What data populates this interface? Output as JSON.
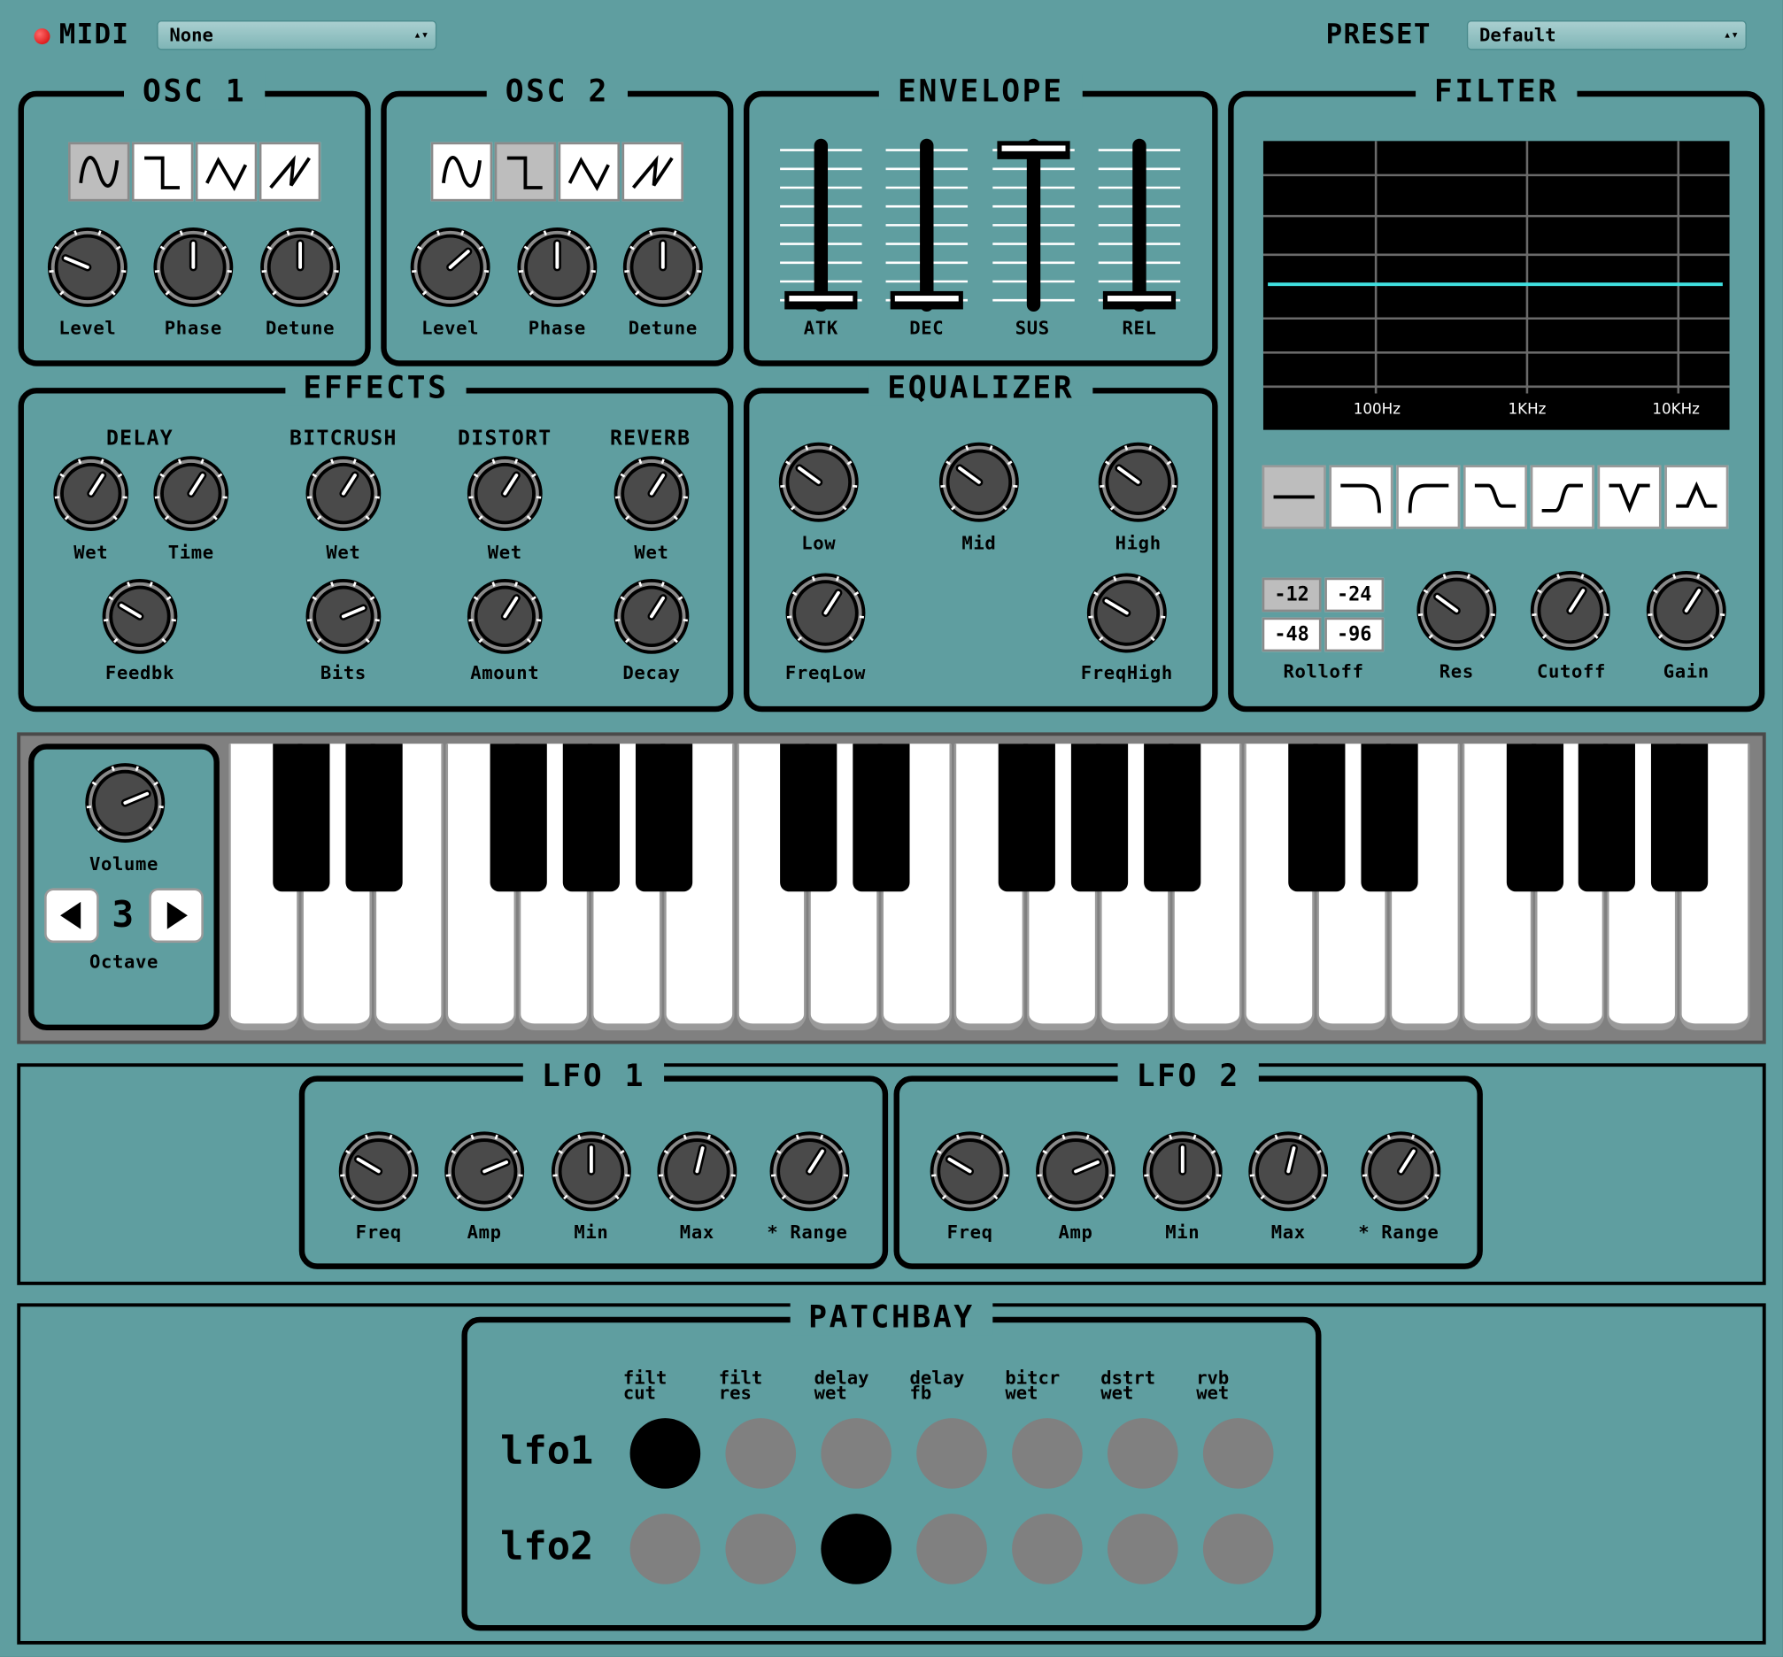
{
  "header": {
    "midi_label": "MIDI",
    "midi_value": "None",
    "preset_label": "PRESET",
    "preset_value": "Default"
  },
  "osc1": {
    "title": "OSC 1",
    "knobs": [
      {
        "label": "Level",
        "value": 0.25
      },
      {
        "label": "Phase",
        "value": 0.5
      },
      {
        "label": "Detune",
        "value": 0.5
      }
    ],
    "waveform": "sine"
  },
  "osc2": {
    "title": "OSC 2",
    "knobs": [
      {
        "label": "Level",
        "value": 0.68
      },
      {
        "label": "Phase",
        "value": 0.5
      },
      {
        "label": "Detune",
        "value": 0.5
      }
    ],
    "waveform": "square"
  },
  "envelope": {
    "title": "ENVELOPE",
    "sliders": [
      {
        "label": "ATK",
        "value": 0
      },
      {
        "label": "DEC",
        "value": 0
      },
      {
        "label": "SUS",
        "value": 1
      },
      {
        "label": "REL",
        "value": 0
      }
    ]
  },
  "filter": {
    "title": "FILTER",
    "freq_labels": [
      "100Hz",
      "1KHz",
      "10KHz"
    ],
    "types": [
      "flat",
      "lowpass",
      "highpass",
      "lowshelf",
      "highshelf",
      "notch",
      "peak"
    ],
    "selected_type": "flat",
    "rolloff_label": "Rolloff",
    "rolloffs": [
      "-12",
      "-24",
      "-48",
      "-96"
    ],
    "selected_rolloff": "-12",
    "knobs": [
      {
        "label": "Res",
        "value": 0.3
      },
      {
        "label": "Cutoff",
        "value": 0.62
      },
      {
        "label": "Gain",
        "value": 0.62
      }
    ],
    "line_color": "#40e0e0"
  },
  "effects": {
    "title": "EFFECTS",
    "sections": [
      "DELAY",
      "BITCRUSH",
      "DISTORT",
      "REVERB"
    ],
    "knobs_top": [
      {
        "label": "Wet",
        "value": 0.62
      },
      {
        "label": "Time",
        "value": 0.62
      },
      {
        "label": "Wet",
        "value": 0.62
      },
      {
        "label": "Wet",
        "value": 0.62
      },
      {
        "label": "Wet",
        "value": 0.62
      }
    ],
    "knobs_bottom": [
      {
        "label": "Feedbk",
        "value": 0.28
      },
      {
        "label": "Bits",
        "value": 0.75
      },
      {
        "label": "Amount",
        "value": 0.62
      },
      {
        "label": "Decay",
        "value": 0.62
      }
    ]
  },
  "equalizer": {
    "title": "EQUALIZER",
    "knobs_top": [
      {
        "label": "Low",
        "value": 0.3
      },
      {
        "label": "Mid",
        "value": 0.3
      },
      {
        "label": "High",
        "value": 0.3
      }
    ],
    "knobs_bottom": [
      {
        "label": "FreqLow",
        "value": 0.62
      },
      {
        "label": "FreqHigh",
        "value": 0.28
      }
    ]
  },
  "keyboard": {
    "volume_label": "Volume",
    "volume_value": 0.75,
    "octave_label": "Octave",
    "octave_value": "3",
    "white_keys": 21
  },
  "lfo1": {
    "title": "LFO 1",
    "knobs": [
      {
        "label": "Freq",
        "value": 0.28
      },
      {
        "label": "Amp",
        "value": 0.75
      },
      {
        "label": "Min",
        "value": 0.5
      },
      {
        "label": "Max",
        "value": 0.55
      },
      {
        "label": "* Range",
        "value": 0.62
      }
    ]
  },
  "lfo2": {
    "title": "LFO 2",
    "knobs": [
      {
        "label": "Freq",
        "value": 0.28
      },
      {
        "label": "Amp",
        "value": 0.75
      },
      {
        "label": "Min",
        "value": 0.5
      },
      {
        "label": "Max",
        "value": 0.55
      },
      {
        "label": "* Range",
        "value": 0.62
      }
    ]
  },
  "patchbay": {
    "title": "PATCHBAY",
    "columns": [
      [
        "filt",
        "cut"
      ],
      [
        "filt",
        "res"
      ],
      [
        "delay",
        "wet"
      ],
      [
        "delay",
        "fb"
      ],
      [
        "bitcr",
        "wet"
      ],
      [
        "dstrt",
        "wet"
      ],
      [
        "rvb",
        "wet"
      ]
    ],
    "rows": [
      {
        "label": "lfo1",
        "active": [
          true,
          false,
          false,
          false,
          false,
          false,
          false
        ]
      },
      {
        "label": "lfo2",
        "active": [
          false,
          false,
          true,
          false,
          false,
          false,
          false
        ]
      }
    ]
  }
}
